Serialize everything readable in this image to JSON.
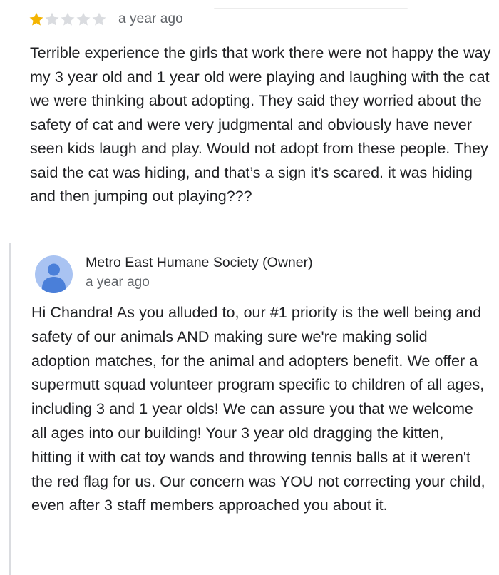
{
  "review": {
    "rating": {
      "value": 1,
      "max": 5,
      "filled_color": "#f4b400",
      "empty_color": "#dadce0",
      "icon": "star-icon"
    },
    "time": "a year ago",
    "text": "Terrible experience the girls that work there were not happy the way my 3 year old and 1 year old were playing and laughing with the cat we were thinking about adopting. They said they worried about the safety of cat and were very judgmental and obviously have never seen kids laugh and play. Would not adopt from these people. They said the cat was hiding, and that’s a sign it’s scared. it was hiding and then jumping out playing???"
  },
  "owner_reply": {
    "avatar_icon": "person-avatar-icon",
    "avatar_color": "#a9c3f2",
    "avatar_figure_color": "#4a7fd9",
    "name": "Metro East Humane Society (Owner)",
    "time": "a year ago",
    "text": "Hi Chandra! As you alluded to, our #1 priority is the well being and safety of our animals AND making sure we're making solid adoption matches, for the animal and adopters benefit. We offer a supermutt squad volunteer program specific to children of all ages, including 3 and 1 year olds! We can assure you that we welcome all ages into our building! Your 3 year old dragging the kitten, hitting it with cat toy wands and throwing tennis balls at it weren't the red flag for us. Our concern was YOU not correcting your child, even after 3 staff members approached you about it."
  }
}
